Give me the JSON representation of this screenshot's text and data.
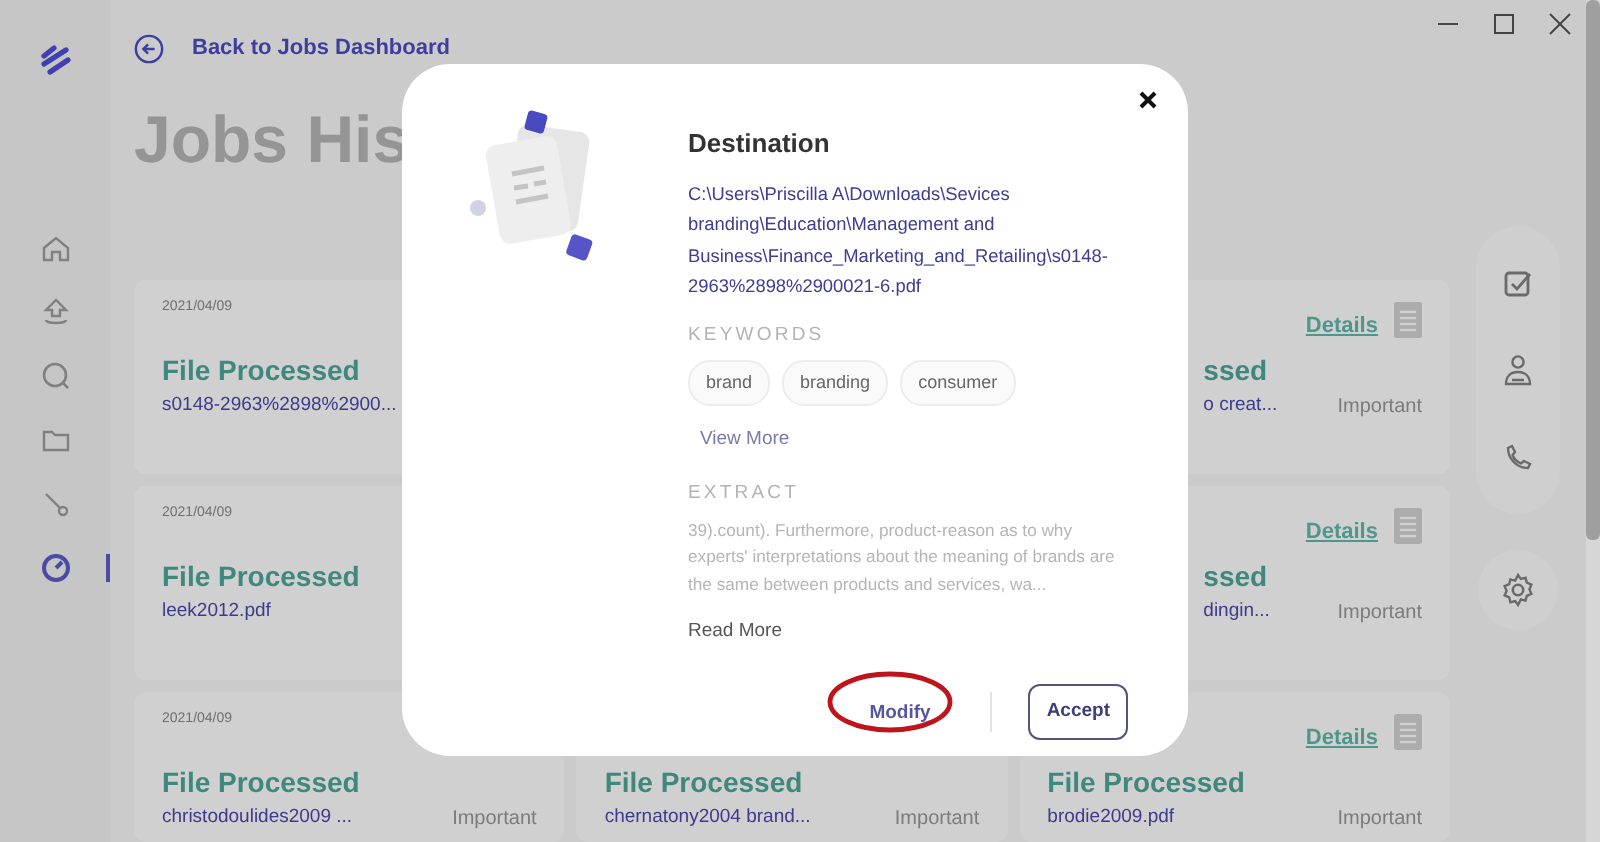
{
  "sidebar": {
    "items": [
      {
        "kind": "home",
        "selected": false
      },
      {
        "kind": "upload",
        "selected": false
      },
      {
        "kind": "search",
        "selected": false
      },
      {
        "kind": "folder",
        "selected": false
      },
      {
        "kind": "connector",
        "selected": false
      },
      {
        "kind": "dashboard",
        "selected": true
      }
    ]
  },
  "header": {
    "back_link": "Back to Jobs Dashboard",
    "title": "Jobs His"
  },
  "job_columns": [
    {
      "cards": [
        {
          "date": "2021/04/09",
          "title": "File Processed",
          "filename": "s0148-2963%2898%2900..."
        },
        {
          "date": "2021/04/09",
          "title": "File Processed",
          "filename": "leek2012.pdf"
        },
        {
          "date": "2021/04/09",
          "title": "File Processed",
          "filename": "christodoulides2009 ...",
          "flag": "Important"
        }
      ]
    },
    {
      "cards": [
        {
          "title": "File Processed",
          "filename": "chernatony2004 brand...",
          "flag": "Important"
        }
      ]
    },
    {
      "cards": [
        {
          "details": "Details",
          "title": "ssed",
          "filename": "o creat...",
          "flag": "Important"
        },
        {
          "details": "Details",
          "title": "ssed",
          "filename": "dingin...",
          "flag": "Important"
        },
        {
          "details": "Details",
          "title": "File Processed",
          "filename": "brodie2009.pdf",
          "flag": "Important"
        }
      ]
    }
  ],
  "modal": {
    "title": "Destination",
    "path": "C:\\Users\\Priscilla A\\Downloads\\Sevices branding\\Education\\Management and Business\\Finance_Marketing_and_Retailing\\s0148-2963%2898%2900021-6.pdf",
    "keywords_label": "KEYWORDS",
    "keywords": [
      "brand",
      "branding",
      "consumer"
    ],
    "view_more": "View More",
    "extract_label": "EXTRACT",
    "extract": "39).count). Furthermore, product-reason as to why experts' interpretations about the meaning of brands are the same between products and services, wa...",
    "read_more": "Read More",
    "buttons": [
      {
        "label": "Modify",
        "kind": "text",
        "highlighted": true
      },
      {
        "label": "Accept",
        "kind": "outline",
        "highlighted": false
      }
    ]
  }
}
